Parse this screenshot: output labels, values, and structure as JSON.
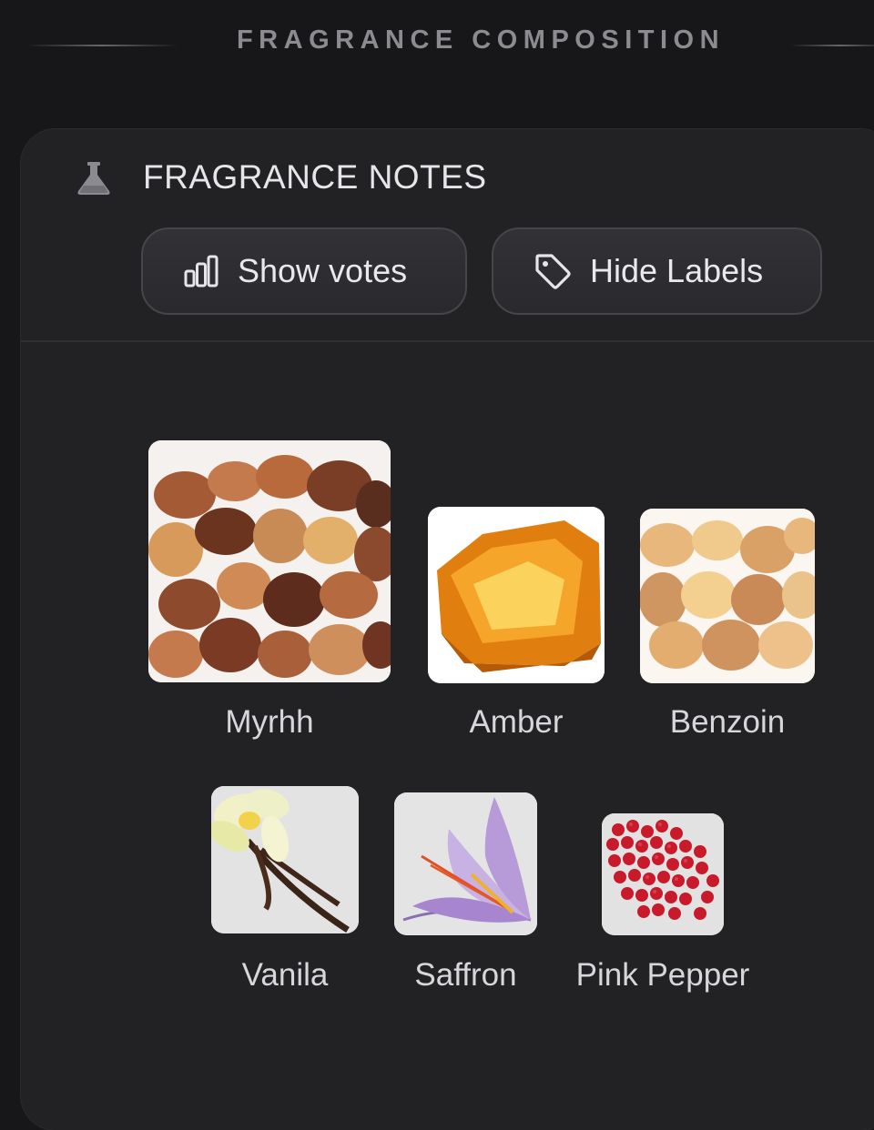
{
  "section": {
    "title": "FRAGRANCE COMPOSITION"
  },
  "card": {
    "icon": "flask-icon",
    "title": "FRAGRANCE NOTES",
    "buttons": {
      "votes": {
        "label": "Show votes",
        "icon": "bar-chart-icon"
      },
      "labels": {
        "label": "Hide Labels",
        "icon": "tag-icon"
      }
    }
  },
  "notes": [
    {
      "name": "Myrhh",
      "image": "myrrh-resin-image"
    },
    {
      "name": "Amber",
      "image": "amber-resin-image"
    },
    {
      "name": "Benzoin",
      "image": "benzoin-resin-image"
    },
    {
      "name": "Vanila",
      "image": "vanilla-flower-image"
    },
    {
      "name": "Saffron",
      "image": "saffron-crocus-image"
    },
    {
      "name": "Pink Pepper",
      "image": "pink-pepper-image"
    }
  ],
  "colors": {
    "background": "#17171a",
    "card": "#222225",
    "button": "#2e2e32",
    "text": "#e6e6ea",
    "muted": "#8b8b90"
  }
}
